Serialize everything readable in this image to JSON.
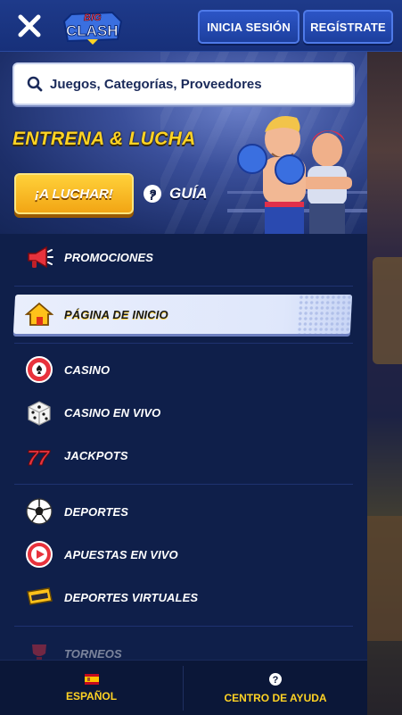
{
  "header": {
    "logo_text_top": "BIG",
    "logo_text_bottom": "CLASH",
    "login_label": "INICIA SESIÓN",
    "register_label": "REGÍSTRATE"
  },
  "search": {
    "placeholder": "Juegos, Categorías, Proveedores"
  },
  "promo": {
    "title": "ENTRENA & LUCHA",
    "cta_label": "¡A LUCHAR!",
    "guide_label": "GUÍA"
  },
  "menu": {
    "items": [
      {
        "label": "PROMOCIONES",
        "icon": "megaphone-icon"
      },
      {
        "label": "PÁGINA DE INICIO",
        "icon": "home-icon",
        "active": true
      },
      {
        "label": "CASINO",
        "icon": "casino-chip-icon"
      },
      {
        "label": "CASINO EN VIVO",
        "icon": "dice-icon"
      },
      {
        "label": "JACKPOTS",
        "icon": "sevens-icon"
      },
      {
        "label": "DEPORTES",
        "icon": "soccer-ball-icon"
      },
      {
        "label": "APUESTAS EN VIVO",
        "icon": "live-play-icon"
      },
      {
        "label": "DEPORTES VIRTUALES",
        "icon": "vr-headset-icon"
      },
      {
        "label": "TORNEOS",
        "icon": "trophy-icon"
      }
    ]
  },
  "footer": {
    "language_label": "ESPAÑOL",
    "help_label": "CENTRO DE AYUDA"
  },
  "colors": {
    "accent_yellow": "#ffd324",
    "header_blue": "#1e3a8a",
    "drawer_bg": "#0f1f4a"
  }
}
